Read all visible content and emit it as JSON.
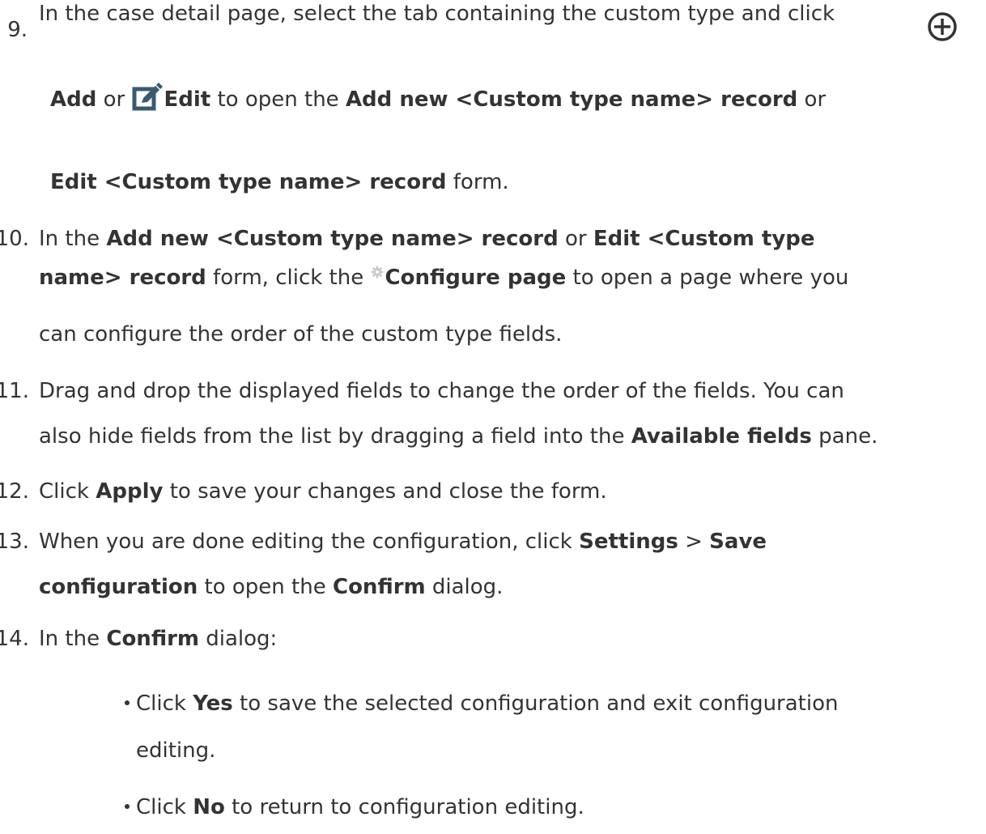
{
  "steps": [
    {
      "number": "9.",
      "lines": [
        {
          "t1": "In the case detail page, select the tab containing the custom type and click"
        },
        {
          "b1": "Add",
          "t1": " or ",
          "b2": "Edit",
          "t2": " to open the ",
          "b3": "Add new <Custom type name> record",
          "t3": " or"
        },
        {
          "b1": "Edit <Custom type name> record",
          "t1": " form."
        }
      ],
      "icons": [
        "add-circle-icon",
        "edit-icon"
      ]
    },
    {
      "number": "10.",
      "lines": [
        {
          "t1": "In the ",
          "b1": "Add new <Custom type name> record",
          "t2": " or ",
          "b2": "Edit <Custom type"
        },
        {
          "b1": "name> record",
          "t1": " form, click the ",
          "b2": "Configure page",
          "t2": " to open a page where you"
        },
        {
          "t1": "can configure the order of the custom type fields."
        }
      ],
      "icons": [
        "gear-icon"
      ]
    },
    {
      "number": "11.",
      "lines": [
        {
          "t1": "Drag and drop the displayed fields to change the order of the fields. You can"
        },
        {
          "t1": "also hide fields from the list by dragging a field into the ",
          "b1": "Available fields",
          "t2": " pane."
        }
      ]
    },
    {
      "number": "12.",
      "lines": [
        {
          "t1": "Click ",
          "b1": "Apply",
          "t2": " to save your changes and close the form."
        }
      ]
    },
    {
      "number": "13.",
      "lines": [
        {
          "t1": "When you are done editing the configuration, click ",
          "b1": "Settings",
          "t2": " > ",
          "b2": "Save"
        },
        {
          "b1": "configuration",
          "t1": " to open the ",
          "b2": "Confirm",
          "t2": " dialog."
        }
      ]
    },
    {
      "number": "14.",
      "lines": [
        {
          "t1": "In the ",
          "b1": "Confirm",
          "t2": " dialog:"
        }
      ]
    }
  ],
  "bullets": [
    {
      "lines": [
        {
          "t1": "Click ",
          "b1": "Yes",
          "t2": " to save the selected configuration and exit configuration"
        },
        {
          "t1": "editing."
        }
      ]
    },
    {
      "lines": [
        {
          "t1": "Click ",
          "b1": "No",
          "t2": " to return to configuration editing."
        }
      ]
    }
  ],
  "colors": {
    "text": "#333333",
    "icon_dark": "#333333",
    "edit_icon": "#3a5a6e",
    "gear_icon": "#c9c9c9"
  }
}
